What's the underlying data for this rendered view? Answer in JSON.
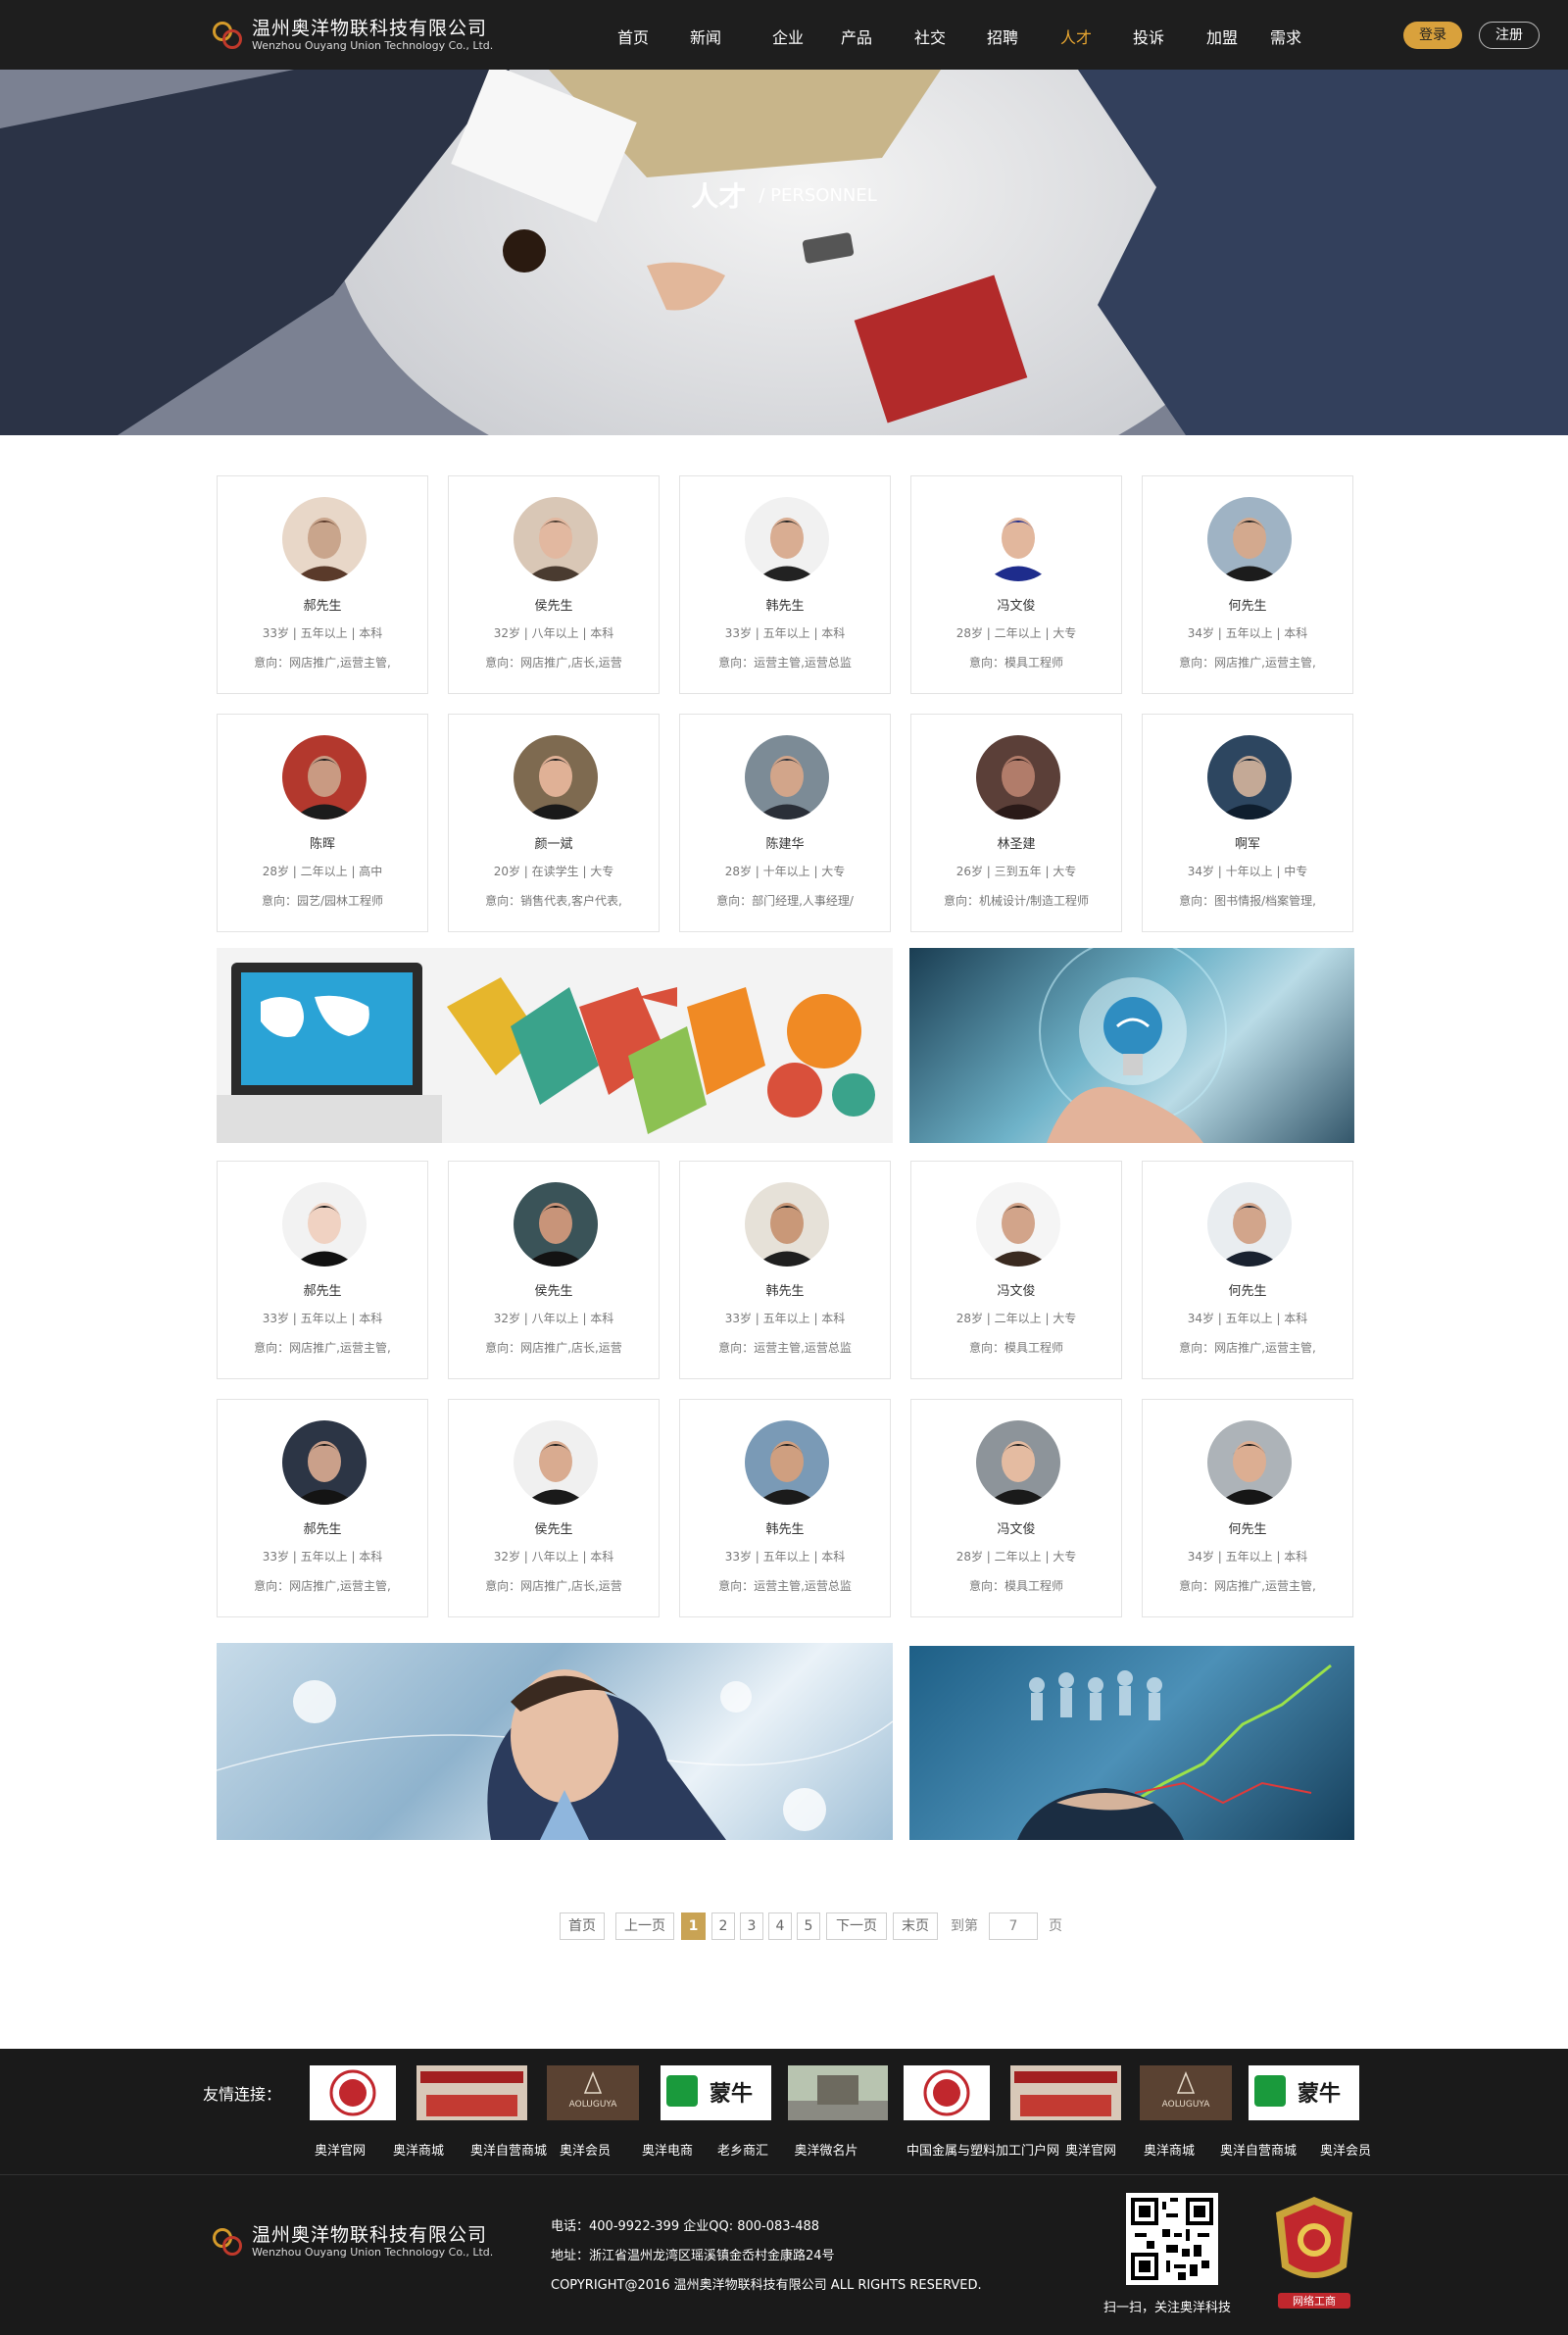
{
  "header": {
    "logo_cn": "温州奥洋物联科技有限公司",
    "logo_en": "Wenzhou Ouyang Union Technology Co., Ltd.",
    "nav": [
      "首页",
      "新闻",
      "企业",
      "产品",
      "社交",
      "招聘",
      "人才",
      "投诉",
      "加盟",
      "需求"
    ],
    "active_nav": "人才",
    "login": "登录",
    "register": "注册"
  },
  "banner": {
    "title_cn": "人才",
    "title_en": "/ PERSONNEL"
  },
  "cards": [
    {
      "name": "郝先生",
      "meta": "33岁 | 五年以上 | 本科",
      "intent": "意向：网店推广,运营主管,",
      "avatar": "woman-glasses"
    },
    {
      "name": "侯先生",
      "meta": "32岁 | 八年以上 | 本科",
      "intent": "意向：网店推广,店长,运营",
      "avatar": "woman-hat"
    },
    {
      "name": "韩先生",
      "meta": "33岁 | 五年以上 | 本科",
      "intent": "意向：运营主管,运营总监",
      "avatar": "man-sunglasses"
    },
    {
      "name": "冯文俊",
      "meta": "28岁 | 二年以上 | 大专",
      "intent": "意向：模具工程师",
      "avatar": "man-blue-goggles"
    },
    {
      "name": "何先生",
      "meta": "34岁 | 五年以上 | 本科",
      "intent": "意向：网店推广,运营主管,",
      "avatar": "man-bridge"
    },
    {
      "name": "陈晖",
      "meta": "28岁 | 二年以上 | 高中",
      "intent": "意向：园艺/园林工程师",
      "avatar": "man-red-wall"
    },
    {
      "name": "颜一斌",
      "meta": "20岁 | 在读学生 | 大专",
      "intent": "意向：销售代表,客户代表,",
      "avatar": "boy-laughing"
    },
    {
      "name": "陈建华",
      "meta": "28岁 | 十年以上 | 大专",
      "intent": "意向：部门经理,人事经理/",
      "avatar": "man-helmet"
    },
    {
      "name": "林圣建",
      "meta": "26岁 | 三到五年 | 大专",
      "intent": "意向：机械设计/制造工程师",
      "avatar": "closeup-face"
    },
    {
      "name": "啊军",
      "meta": "34岁 | 十年以上 | 中专",
      "intent": "意向：图书情报/档案管理,",
      "avatar": "crowd"
    },
    {
      "name": "郝先生",
      "meta": "33岁 | 五年以上 | 本科",
      "intent": "意向：网店推广,运营主管,",
      "avatar": "woman-black-hair"
    },
    {
      "name": "侯先生",
      "meta": "32岁 | 八年以上 | 本科",
      "intent": "意向：网店推广,店长,运营",
      "avatar": "man-dark-teal"
    },
    {
      "name": "韩先生",
      "meta": "33岁 | 五年以上 | 本科",
      "intent": "意向：运营主管,运营总监",
      "avatar": "man-suit-glasses"
    },
    {
      "name": "冯文俊",
      "meta": "28岁 | 二年以上 | 大专",
      "intent": "意向：模具工程师",
      "avatar": "man-beard"
    },
    {
      "name": "何先生",
      "meta": "34岁 | 五年以上 | 本科",
      "intent": "意向：网店推广,运营主管,",
      "avatar": "man-full-suit"
    },
    {
      "name": "郝先生",
      "meta": "33岁 | 五年以上 | 本科",
      "intent": "意向：网店推广,运营主管,",
      "avatar": "man-smile-dark"
    },
    {
      "name": "侯先生",
      "meta": "32岁 | 八年以上 | 本科",
      "intent": "意向：网店推广,店长,运营",
      "avatar": "man-green-tie"
    },
    {
      "name": "韩先生",
      "meta": "33岁 | 五年以上 | 本科",
      "intent": "意向：运营主管,运营总监",
      "avatar": "man-city"
    },
    {
      "name": "冯文俊",
      "meta": "28岁 | 二年以上 | 大专",
      "intent": "意向：模具工程师",
      "avatar": "man-gray-bg"
    },
    {
      "name": "何先生",
      "meta": "34岁 | 五年以上 | 本科",
      "intent": "意向：网店推广,运营主管,",
      "avatar": "man-white-shirt"
    }
  ],
  "pagination": {
    "first": "首页",
    "prev": "上一页",
    "pages": [
      "1",
      "2",
      "3",
      "4",
      "5"
    ],
    "current": "1",
    "next": "下一页",
    "last": "末页",
    "goto_label": "到第",
    "goto_value": "7",
    "page_unit": "页"
  },
  "links": {
    "label": "友情连接：",
    "names": [
      "奥洋官网",
      "奥洋商城",
      "奥洋自营商城",
      "奥洋会员",
      "奥洋电商",
      "老乡商汇",
      "奥洋微名片",
      "中国金属与塑料加工门户网",
      "奥洋官网",
      "奥洋商城",
      "奥洋自营商城",
      "奥洋会员"
    ],
    "logo_texts": [
      "AOLUGUYA",
      "蒙牛"
    ]
  },
  "footer": {
    "phone": "电话：400-9922-399   企业QQ: 800-083-488",
    "address": "地址：浙江省温州龙湾区瑶溪镇金岙村金康路24号",
    "copyright": "COPYRIGHT@2016 温州奥洋物联科技有限公司 ALL RIGHTS RESERVED.",
    "qr_caption": "扫一扫，关注奥洋科技",
    "badge_label": "网络工商"
  },
  "colors": {
    "accent": "#e8a630",
    "header_bg": "#1e1e1e",
    "footer_bg": "#1a1a1a",
    "pager_active": "#c9a354"
  }
}
